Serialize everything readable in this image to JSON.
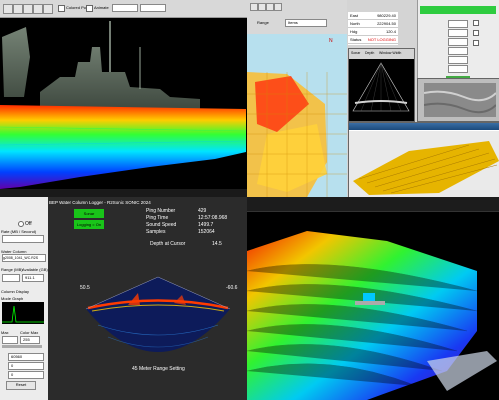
{
  "q1": {
    "toolbar_labels": [
      "Colored Points",
      "Animate"
    ]
  },
  "q2": {
    "toolbar": {
      "range_label": "Range",
      "range_value": "Items"
    },
    "readout": {
      "rows": [
        {
          "label": "East",
          "value": "980229.40"
        },
        {
          "label": "North",
          "value": "222904.50"
        },
        {
          "label": "Hdg",
          "value": "120.4"
        },
        {
          "label": "Status",
          "value": "NOT LOGGING"
        }
      ]
    },
    "sonar_small_header": [
      "Sonar",
      "Depth",
      "Window Width"
    ]
  },
  "q3": {
    "title": "BEP Water Column Logger - R2Sonic SONIC 2024",
    "left": {
      "radio_off": "Off",
      "rate_label": "Rate (MB / Second)",
      "water_column_label": "Water Column",
      "file_path": "g2008_1041_WC.R2S",
      "range_mb_label": "Range (MB)",
      "available_gb_label": "Available (GB)",
      "available_value": "911.1",
      "column_display_label": "Column Display",
      "mode_graph_label": "Mode Graph",
      "max_label": "Max",
      "color_max_label": "Color Max",
      "color_max_value": "255",
      "value_1": "60560",
      "value_2": "0",
      "value_3": "0",
      "reset_label": "Reset"
    },
    "status_buttons": [
      "Sonar",
      "Logging = On"
    ],
    "info": [
      {
        "label": "Ping Number",
        "value": "429"
      },
      {
        "label": "Ping Time",
        "value": "12:57:08.968"
      },
      {
        "label": "Sound Speed",
        "value": "1499.7"
      },
      {
        "label": "Samples",
        "value": "152064"
      }
    ],
    "depth_at_cursor_label": "Depth at Cursor",
    "depth_at_cursor_value": "14.5",
    "angle_left": "50.5",
    "angle_right": "-60.6",
    "range_setting": "45 Meter Range Setting"
  }
}
